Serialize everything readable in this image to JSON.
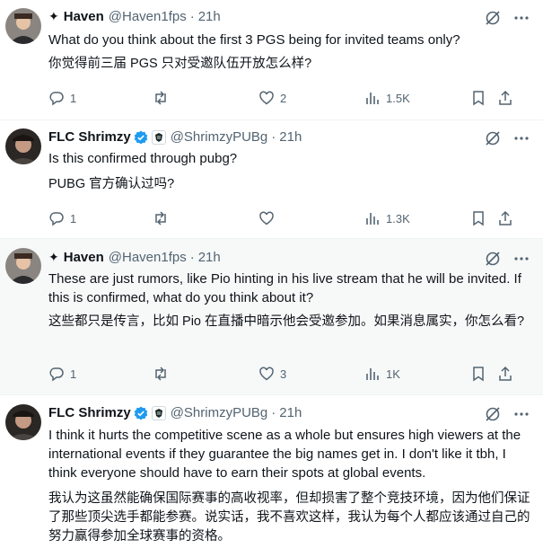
{
  "tweets": [
    {
      "name": "Haven",
      "name_prefix": "✦",
      "handle": "@Haven1fps",
      "time": "21h",
      "verified": false,
      "text_en": "What do you think about the first 3 PGS being for invited teams only?",
      "text_zh": "你觉得前三届 PGS 只对受邀队伍开放怎么样?",
      "replies": "1",
      "retweets": "",
      "likes": "2",
      "views": "1.5K"
    },
    {
      "name": "FLC Shrimzy",
      "name_prefix": "",
      "handle": "@ShrimzyPUBg",
      "time": "21h",
      "verified": true,
      "text_en": "Is this confirmed through pubg?",
      "text_zh": "PUBG 官方确认过吗?",
      "replies": "1",
      "retweets": "",
      "likes": "",
      "views": "1.3K"
    },
    {
      "name": "Haven",
      "name_prefix": "✦",
      "handle": "@Haven1fps",
      "time": "21h",
      "verified": false,
      "text_en": "These are just rumors, like Pio hinting in his live stream that he will be invited. If this is confirmed, what do you think about it?",
      "text_zh": "这些都只是传言，比如 Pio 在直播中暗示他会受邀参加。如果消息属实，你怎么看?",
      "replies": "1",
      "retweets": "",
      "likes": "3",
      "views": "1K"
    },
    {
      "name": "FLC Shrimzy",
      "name_prefix": "",
      "handle": "@ShrimzyPUBg",
      "time": "21h",
      "verified": true,
      "text_en": "I think it hurts the competitive scene as a whole but ensures high viewers at the international events if they guarantee the big names get in. I don't like it tbh, I think everyone should have to earn their spots at global events.",
      "text_zh": "我认为这虽然能确保国际赛事的高收视率，但却损害了整个竞技环境，因为他们保证了那些顶尖选手都能参赛。说实话，我不喜欢这样，我认为每个人都应该通过自己的努力赢得参加全球赛事的资格。"
    }
  ],
  "colors": {
    "text": "#0f1419",
    "muted": "#536471",
    "verified": "#1d9bf0",
    "highlight_bg": "#f7f9f9"
  },
  "icons": [
    "grok-icon",
    "more-icon",
    "reply-icon",
    "retweet-icon",
    "like-icon",
    "views-icon",
    "bookmark-icon",
    "share-icon",
    "verified-badge-icon",
    "affiliate-badge-icon"
  ]
}
